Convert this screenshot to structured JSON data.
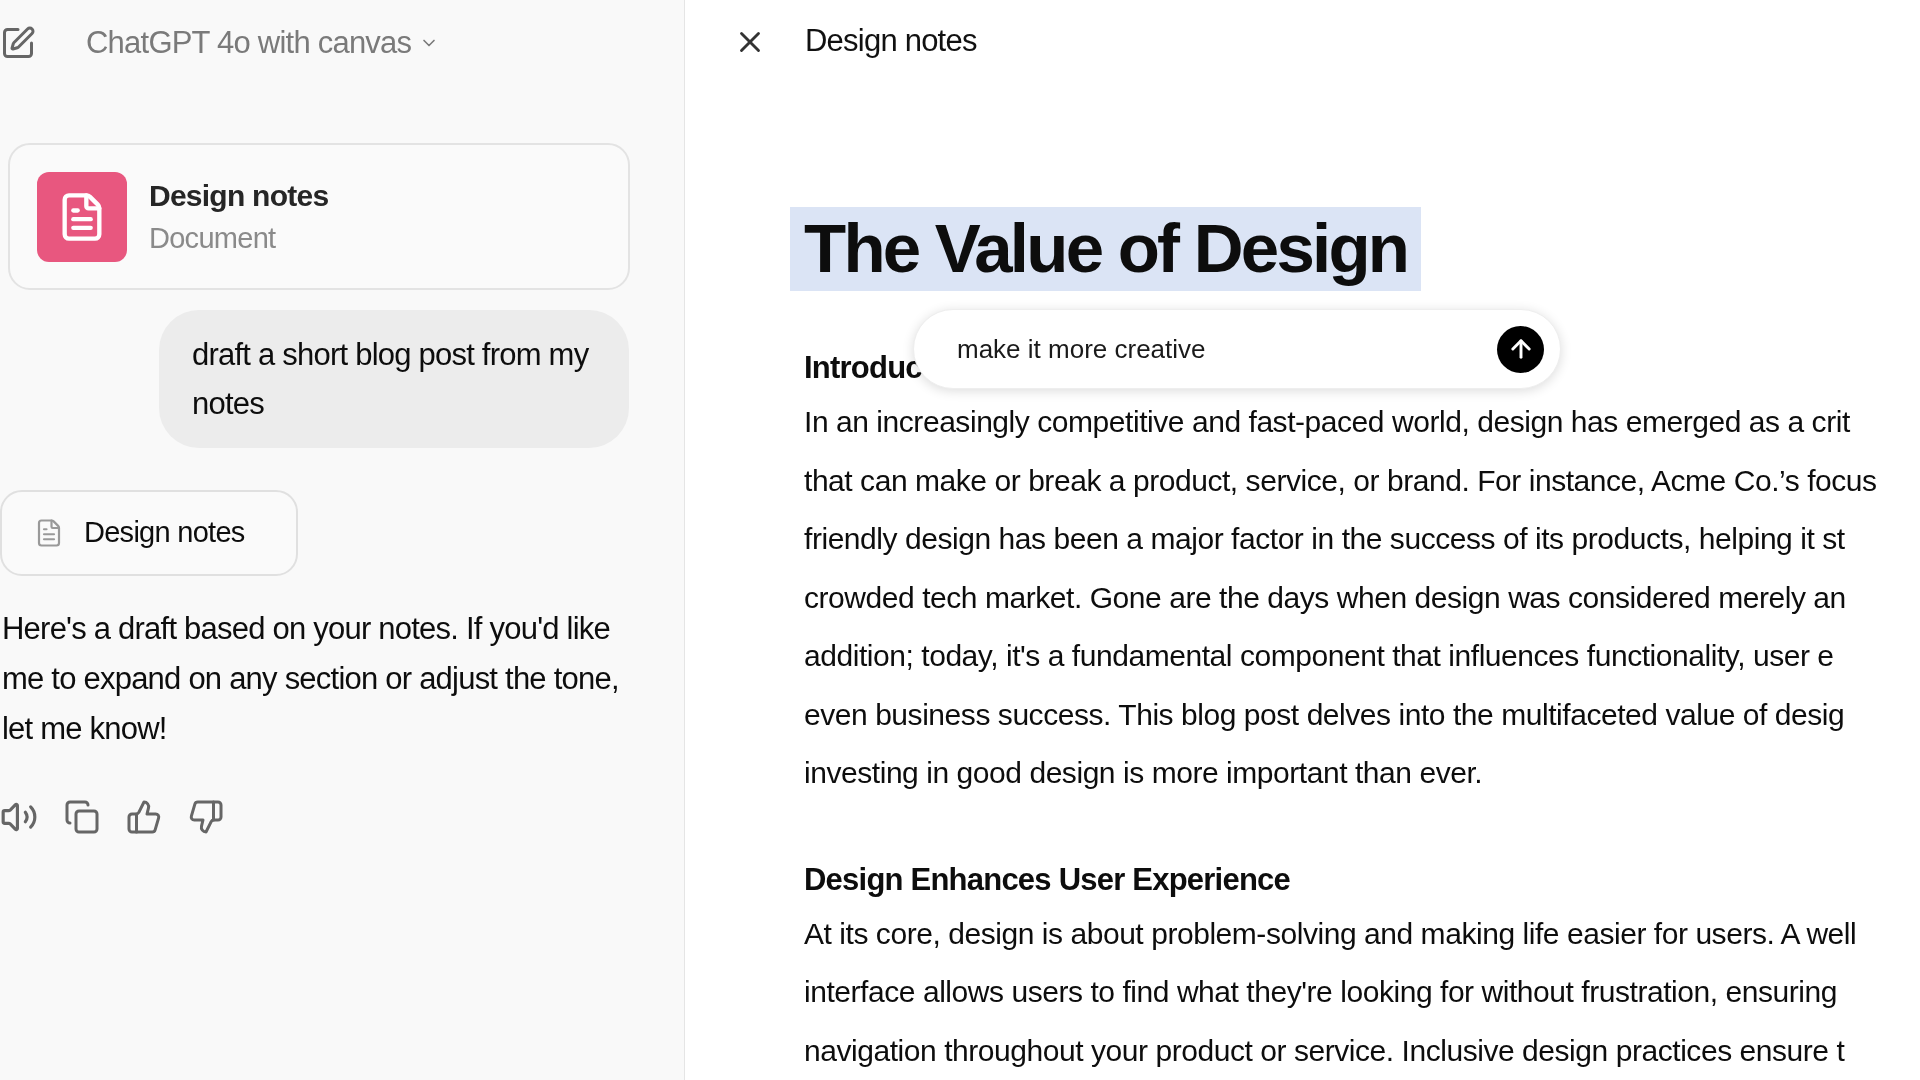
{
  "sidebar": {
    "model": "ChatGPT 4o with canvas",
    "document_card": {
      "title": "Design notes",
      "subtitle": "Document"
    },
    "user_message": "draft a short blog post from my notes",
    "document_chip": "Design notes",
    "assistant_message": "Here's a draft based on your notes. If you'd like me to expand on any section or adjust the tone, let me know!"
  },
  "canvas": {
    "title": "Design notes",
    "document": {
      "title": "The Value of Design",
      "title_selected": true,
      "sections": [
        {
          "heading": "Introduc",
          "lines": [
            "In an increasingly competitive and fast-paced world, design has emerged as a crit",
            "that can make or break a product, service, or brand. For instance, Acme Co.’s focus",
            "friendly design has been a major factor in the success of its products, helping it st",
            "crowded tech market. Gone are the days when design was considered merely an",
            "addition; today, it's a fundamental component that influences functionality, user e",
            "even business success. This blog post delves into the multifaceted value of desig",
            "investing in good design is more important than ever."
          ]
        },
        {
          "heading": "Design Enhances User Experience",
          "lines": [
            "At its core, design is about problem-solving and making life easier for users. A well",
            "interface allows users to find what they're looking for without frustration, ensuring",
            "navigation throughout your product or service. Inclusive design practices ensure t"
          ]
        }
      ]
    },
    "edit_prompt": {
      "value": "make it more creative"
    }
  }
}
